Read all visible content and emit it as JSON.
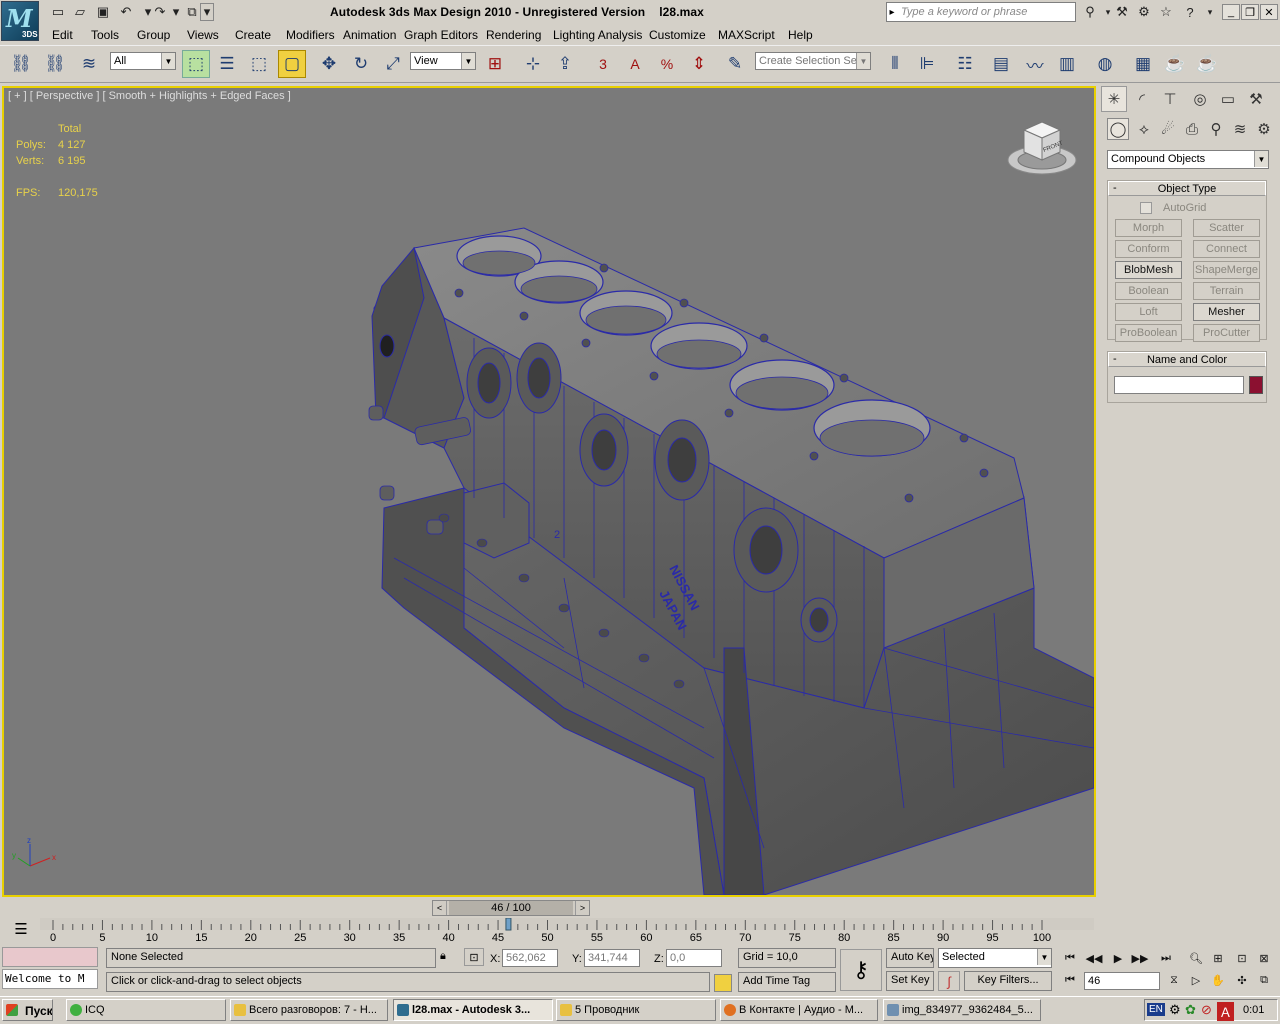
{
  "app": {
    "title": "Autodesk 3ds Max Design 2010  -  Unregistered Version",
    "filename": "l28.max",
    "logo_text": "3DS"
  },
  "search": {
    "placeholder": "Type a keyword or phrase"
  },
  "menu": [
    "Edit",
    "Tools",
    "Group",
    "Views",
    "Create",
    "Modifiers",
    "Animation",
    "Graph Editors",
    "Rendering",
    "Lighting Analysis",
    "Customize",
    "MAXScript",
    "Help"
  ],
  "toolbar": {
    "filter_value": "All",
    "refcoord_value": "View",
    "named_selection_placeholder": "Create Selection Se",
    "snap_label": "3",
    "angle_snap_label": "A",
    "percent_snap_label": "%"
  },
  "viewport": {
    "label": "[ + ] [ Perspective ] [ Smooth + Highlights + Edged Faces ]",
    "stats": {
      "header": "Total",
      "polys_label": "Polys:",
      "polys_value": "4 127",
      "verts_label": "Verts:",
      "verts_value": "6 195",
      "fps_label": "FPS:",
      "fps_value": "120,175"
    },
    "axes": {
      "x": "x",
      "y": "y",
      "z": "z"
    },
    "viewcube_label": "FRONT",
    "block_text1": "NISSAN",
    "block_text2": "JAPAN",
    "block_mark": "2"
  },
  "command_panel": {
    "category": "Compound Objects",
    "object_type_title": "Object Type",
    "autogrid_label": "AutoGrid",
    "buttons": [
      {
        "label": "Morph",
        "enabled": false
      },
      {
        "label": "Scatter",
        "enabled": false
      },
      {
        "label": "Conform",
        "enabled": false
      },
      {
        "label": "Connect",
        "enabled": false
      },
      {
        "label": "BlobMesh",
        "enabled": true
      },
      {
        "label": "ShapeMerge",
        "enabled": false
      },
      {
        "label": "Boolean",
        "enabled": false
      },
      {
        "label": "Terrain",
        "enabled": false
      },
      {
        "label": "Loft",
        "enabled": false
      },
      {
        "label": "Mesher",
        "enabled": true
      },
      {
        "label": "ProBoolean",
        "enabled": false
      },
      {
        "label": "ProCutter",
        "enabled": false
      }
    ],
    "name_color_title": "Name and Color",
    "name_value": "",
    "object_color": "#8b1030"
  },
  "timeline": {
    "slider_label": "46 / 100",
    "ticks": [
      "0",
      "5",
      "10",
      "15",
      "20",
      "25",
      "30",
      "35",
      "40",
      "45",
      "50",
      "55",
      "60",
      "65",
      "70",
      "75",
      "80",
      "85",
      "90",
      "95",
      "100"
    ],
    "current_frame": 46
  },
  "status": {
    "selection_text": "None Selected",
    "prompt": "Click or click-and-drag to select objects",
    "maxscript_text": "Welcome to M",
    "x_label": "X:",
    "x_value": "562,062",
    "y_label": "Y:",
    "y_value": "341,744",
    "z_label": "Z:",
    "z_value": "0,0",
    "grid": "Grid = 10,0",
    "add_time_tag": "Add Time Tag",
    "auto_key": "Auto Key",
    "set_key": "Set Key",
    "key_filter_select": "Selected",
    "key_filters": "Key Filters...",
    "frame_value": "46"
  },
  "taskbar": {
    "start": "Пуск",
    "tasks": [
      "ICQ",
      "Всего разговоров: 7 - Н...",
      "l28.max - Autodesk 3...",
      "5 Проводник",
      "В Контакте | Аудио - М...",
      "img_834977_9362484_5..."
    ],
    "lang": "EN",
    "clock": "0:01"
  },
  "colors": {
    "viewport_bg": "#7a7a7a",
    "active_border": "#e8d000",
    "stats_text": "#e8d24a",
    "mesh_edge": "#2a2aa8"
  }
}
